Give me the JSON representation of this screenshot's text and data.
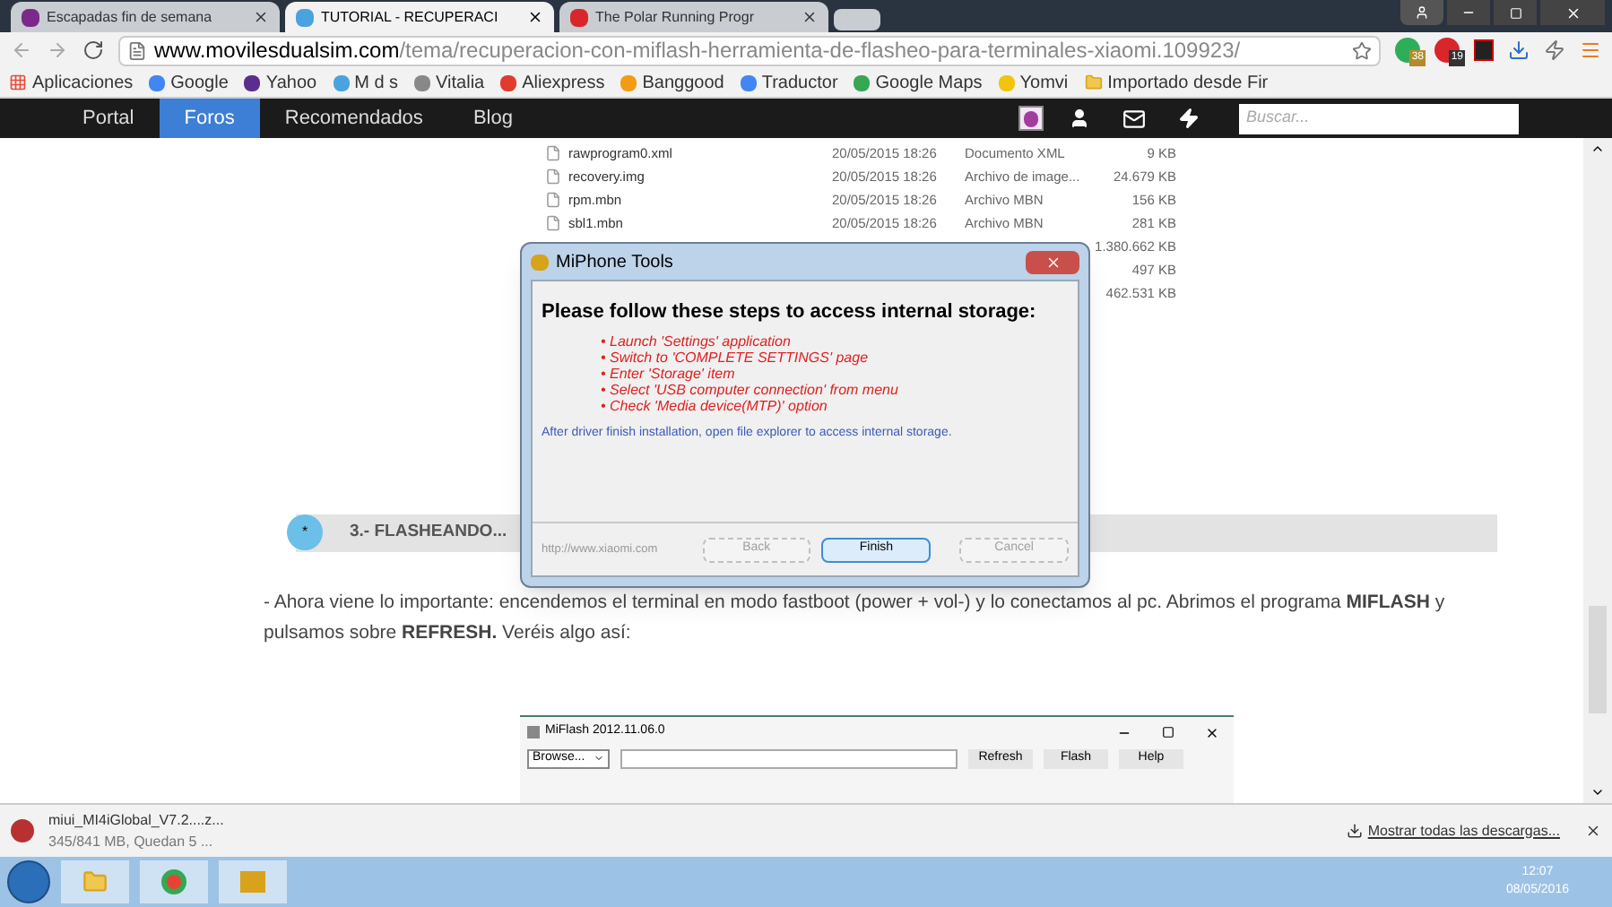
{
  "browser": {
    "tabs": [
      {
        "title": "Escapadas fin de semana",
        "selected": false
      },
      {
        "title": "TUTORIAL - RECUPERACI",
        "selected": true
      },
      {
        "title": "The Polar Running Progr",
        "selected": false
      }
    ],
    "url_host": "www.movilesdualsim.com",
    "url_path": "/tema/recuperacion-con-miflash-herramienta-de-flasheo-para-terminales-xiaomi.109923/",
    "extension_badges": [
      "38",
      "19"
    ],
    "bookmarks": [
      "Aplicaciones",
      "Google",
      "Yahoo",
      "M d s",
      "Vitalia",
      "Aliexpress",
      "Banggood",
      "Traductor",
      "Google Maps",
      "Yomvi",
      "Importado desde Fir"
    ]
  },
  "site_nav": {
    "items": [
      {
        "label": "Portal",
        "selected": false
      },
      {
        "label": "Foros",
        "selected": true
      },
      {
        "label": "Recomendados",
        "selected": false
      },
      {
        "label": "Blog",
        "selected": false
      }
    ],
    "search_placeholder": "Buscar..."
  },
  "file_list": [
    {
      "name": "rawprogram0.xml",
      "date": "20/05/2015 18:26",
      "type": "Documento XML",
      "size": "9 KB"
    },
    {
      "name": "recovery.img",
      "date": "20/05/2015 18:26",
      "type": "Archivo de image...",
      "size": "24.679 KB"
    },
    {
      "name": "rpm.mbn",
      "date": "20/05/2015 18:26",
      "type": "Archivo MBN",
      "size": "156 KB"
    },
    {
      "name": "sbl1.mbn",
      "date": "20/05/2015 18:26",
      "type": "Archivo MBN",
      "size": "281 KB"
    },
    {
      "size": "1.380.662 KB"
    },
    {
      "size": "497 KB"
    },
    {
      "size": "462.531 KB"
    }
  ],
  "dialog": {
    "title": "MiPhone Tools",
    "heading": "Please follow these steps to access internal storage:",
    "steps": [
      "• Launch 'Settings' application",
      "• Switch to 'COMPLETE SETTINGS' page",
      "• Enter 'Storage' item",
      "• Select 'USB computer connection' from menu",
      "• Check 'Media device(MTP)' option"
    ],
    "note": "After driver finish installation, open file explorer to access internal storage.",
    "link": "http://www.xiaomi.com",
    "buttons": [
      {
        "label": "Back",
        "disabled": true,
        "selected": false
      },
      {
        "label": "Finish",
        "disabled": false,
        "selected": true
      },
      {
        "label": "Cancel",
        "disabled": true,
        "selected": false
      }
    ]
  },
  "section_bullet": "*",
  "section_heading": "3.- FLASHEANDO...",
  "paragraph": "- Ahora viene lo importante: encendemos el terminal en modo fastboot (power + vol-) y lo conectamos al pc. Abrimos el programa **MIFLASH** y pulsamos sobre **REFRESH.** Veréis algo así:",
  "miflash": {
    "title": "MiFlash 2012.11.06.0",
    "browse": "Browse...",
    "buttons": [
      "Refresh",
      "Flash",
      "Help"
    ]
  },
  "download": {
    "file": "miui_MI4iGlobal_V7.2....z...",
    "status": "345/841 MB, Quedan 5 ...",
    "show_all": "Mostrar todas las descargas..."
  },
  "taskbar": {
    "time": "12:07",
    "date": "08/05/2016"
  }
}
